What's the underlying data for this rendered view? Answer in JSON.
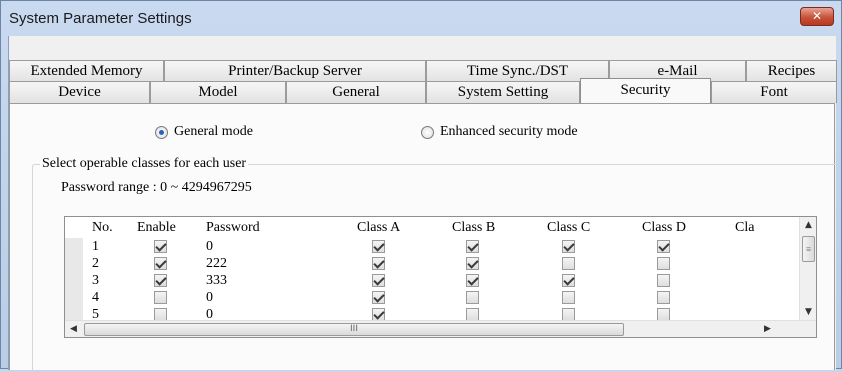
{
  "window": {
    "title": "System Parameter Settings",
    "close_glyph": "✕"
  },
  "tabs_row1": [
    {
      "label": "Extended Memory"
    },
    {
      "label": "Printer/Backup Server"
    },
    {
      "label": "Time Sync./DST"
    },
    {
      "label": "e-Mail"
    },
    {
      "label": "Recipes"
    }
  ],
  "tabs_row2": [
    {
      "label": "Device"
    },
    {
      "label": "Model"
    },
    {
      "label": "General"
    },
    {
      "label": "System Setting"
    },
    {
      "label": "Security",
      "active": true
    },
    {
      "label": "Font"
    }
  ],
  "security": {
    "mode_general": {
      "label": "General mode",
      "selected": true
    },
    "mode_enhanced": {
      "label": "Enhanced security mode",
      "selected": false
    },
    "group_title": "Select operable classes for each user",
    "password_range": "Password range : 0 ~ 4294967295",
    "columns": [
      "No.",
      "Enable",
      "Password",
      "Class A",
      "Class B",
      "Class C",
      "Class D",
      "Clas"
    ],
    "rows": [
      {
        "no": "1",
        "enable": true,
        "password": "0",
        "a": true,
        "b": true,
        "c": true,
        "d": true
      },
      {
        "no": "2",
        "enable": true,
        "password": "222",
        "a": true,
        "b": true,
        "c": false,
        "d": false
      },
      {
        "no": "3",
        "enable": true,
        "password": "333",
        "a": true,
        "b": true,
        "c": true,
        "d": false
      },
      {
        "no": "4",
        "enable": false,
        "password": "0",
        "a": true,
        "b": false,
        "c": false,
        "d": false
      },
      {
        "no": "5",
        "enable": false,
        "password": "0",
        "a": true,
        "b": false,
        "c": false,
        "d": false
      }
    ],
    "hscroll_grip": "III",
    "vscroll_grip": "≡"
  },
  "colors": {
    "accent": "#2a63b8",
    "titlebar": "#c9daf0",
    "close": "#c6523a"
  }
}
